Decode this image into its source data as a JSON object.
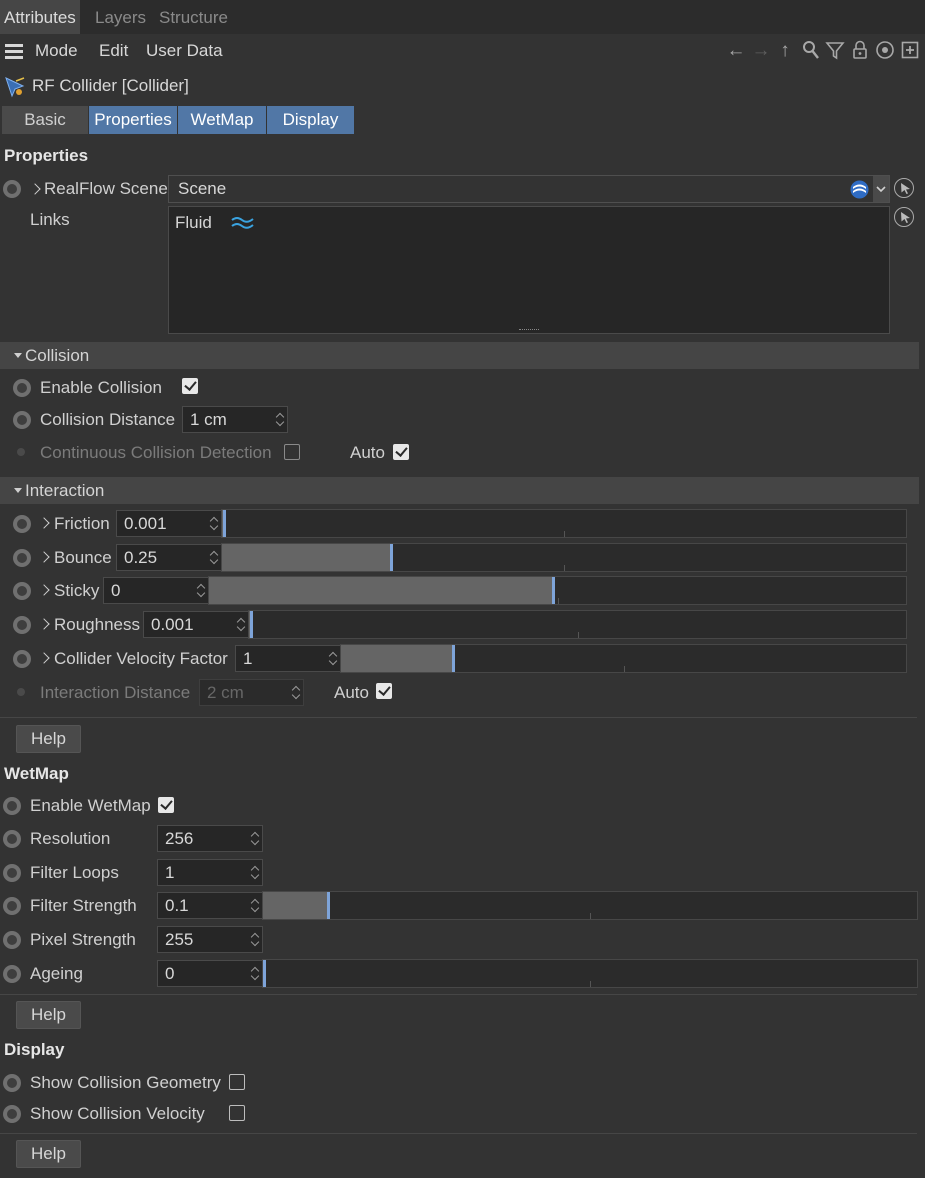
{
  "top_tabs": [
    "Attributes",
    "Layers",
    "Structure"
  ],
  "menu": {
    "mode": "Mode",
    "edit": "Edit",
    "user_data": "User Data"
  },
  "toolbar_icons": [
    "arrow-left-icon",
    "arrow-right-icon",
    "arrow-up-icon",
    "search-icon",
    "filter-icon",
    "lock-icon",
    "target-icon",
    "new-panel-icon"
  ],
  "object": {
    "title": "RF Collider [Collider]"
  },
  "property_tabs": [
    "Basic",
    "Properties",
    "WetMap",
    "Display"
  ],
  "properties": {
    "heading": "Properties",
    "realflow_scene_label": "RealFlow Scene",
    "realflow_scene_value": "Scene",
    "links_label": "Links",
    "links_items": [
      "Fluid"
    ]
  },
  "collision": {
    "group_label": "Collision",
    "enable_label": "Enable Collision",
    "enable_checked": true,
    "distance_label": "Collision Distance",
    "distance_value": "1 cm",
    "ccd_label": "Continuous Collision Detection",
    "ccd_checked": false,
    "ccd_auto_label": "Auto",
    "ccd_auto_checked": true
  },
  "interaction": {
    "group_label": "Interaction",
    "rows": [
      {
        "label": "Friction",
        "value": "0.001",
        "slider_fraction": 0.001
      },
      {
        "label": "Bounce",
        "value": "0.25",
        "slider_fraction": 0.25
      },
      {
        "label": "Sticky",
        "value": "0",
        "slider_fraction": 0.5
      },
      {
        "label": "Roughness",
        "value": "0.001",
        "slider_fraction": 0.001
      },
      {
        "label": "Collider Velocity Factor",
        "value": "1",
        "slider_fraction": 0.2
      }
    ],
    "distance_label": "Interaction Distance",
    "distance_value": "2 cm",
    "distance_auto_label": "Auto",
    "distance_auto_checked": true
  },
  "help_label": "Help",
  "wetmap": {
    "heading": "WetMap",
    "enable_label": "Enable WetMap",
    "enable_checked": true,
    "resolution_label": "Resolution",
    "resolution_value": "256",
    "filter_loops_label": "Filter Loops",
    "filter_loops_value": "1",
    "filter_strength_label": "Filter Strength",
    "filter_strength_value": "0.1",
    "filter_strength_fraction": 0.1,
    "pixel_strength_label": "Pixel Strength",
    "pixel_strength_value": "255",
    "ageing_label": "Ageing",
    "ageing_value": "0",
    "ageing_fraction": 0
  },
  "display": {
    "heading": "Display",
    "show_geometry_label": "Show Collision Geometry",
    "show_geometry_checked": false,
    "show_velocity_label": "Show Collision Velocity",
    "show_velocity_checked": false
  }
}
